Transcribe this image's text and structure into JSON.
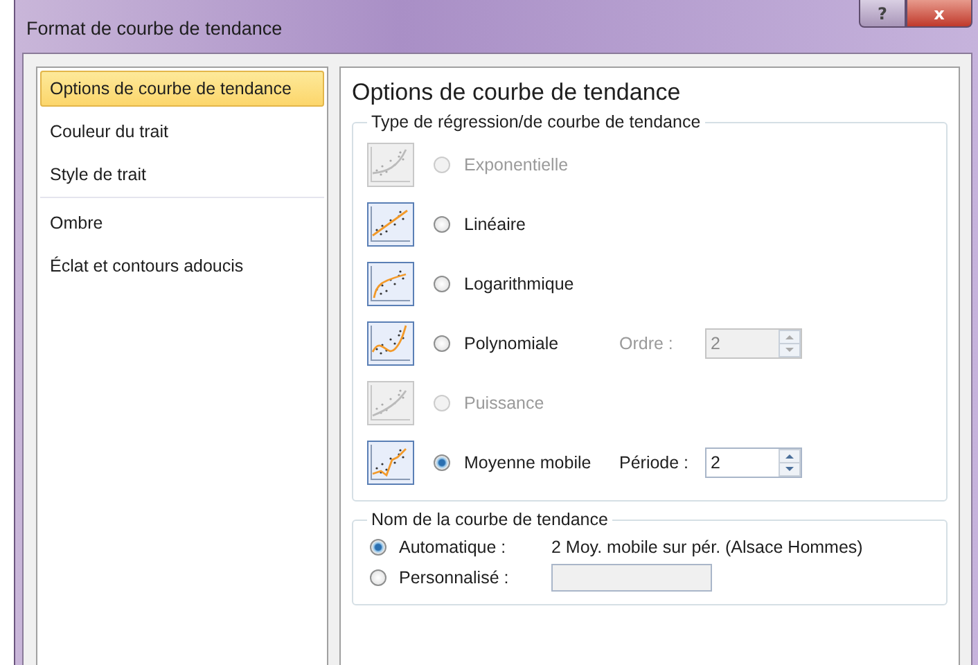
{
  "window": {
    "title": "Format de courbe de tendance",
    "help_button": "?",
    "close_button": "x"
  },
  "sidebar": {
    "items": [
      {
        "label": "Options de courbe de tendance",
        "selected": true,
        "separator_after": false
      },
      {
        "label": "Couleur du trait",
        "selected": false,
        "separator_after": false
      },
      {
        "label": "Style de trait",
        "selected": false,
        "separator_after": true
      },
      {
        "label": "Ombre",
        "selected": false,
        "separator_after": false
      },
      {
        "label": "Éclat et contours adoucis",
        "selected": false,
        "separator_after": false
      }
    ]
  },
  "panel": {
    "heading": "Options de courbe de tendance",
    "regression": {
      "legend": "Type de régression/de courbe de tendance",
      "options": [
        {
          "kind": "exponential",
          "label": "Exponentielle",
          "selected": false,
          "disabled": true
        },
        {
          "kind": "linear",
          "label": "Linéaire",
          "selected": false,
          "disabled": false
        },
        {
          "kind": "logarithmic",
          "label": "Logarithmique",
          "selected": false,
          "disabled": false
        },
        {
          "kind": "polynomial",
          "label": "Polynomiale",
          "selected": false,
          "disabled": false,
          "param": {
            "label": "Ordre :",
            "value": "2",
            "disabled": true
          }
        },
        {
          "kind": "power",
          "label": "Puissance",
          "selected": false,
          "disabled": true
        },
        {
          "kind": "moving",
          "label": "Moyenne mobile",
          "selected": true,
          "disabled": false,
          "param": {
            "label": "Période :",
            "value": "2",
            "disabled": false
          }
        }
      ]
    },
    "name": {
      "legend": "Nom de la courbe de tendance",
      "options": [
        {
          "label": "Automatique :",
          "selected": true,
          "value": "2 Moy. mobile sur pér. (Alsace Hommes)"
        },
        {
          "label": "Personnalisé :",
          "selected": false
        }
      ]
    }
  }
}
